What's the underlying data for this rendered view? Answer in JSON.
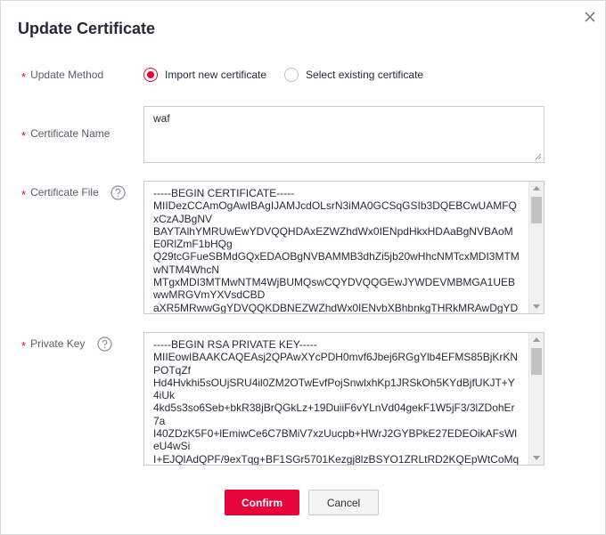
{
  "dialog": {
    "title": "Update Certificate",
    "close_icon": "close-icon"
  },
  "form": {
    "required_mark": "*",
    "update_method": {
      "label": "Update Method",
      "options": [
        {
          "label": "Import new certificate",
          "checked": true
        },
        {
          "label": "Select existing certificate",
          "checked": false
        }
      ]
    },
    "certificate_name": {
      "label": "Certificate Name",
      "value": "waf"
    },
    "certificate_file": {
      "label": "Certificate File",
      "help_icon": "question-circle-icon",
      "lines": [
        "-----BEGIN CERTIFICATE-----",
        "MIIDezCCAmOgAwIBAgIJAMJcdOLsrN3iMA0GCSqGSIb3DQEBCwUAMFQ",
        "xCzAJBgNV",
        "BAYTAlhYMRUwEwYDVQQHDAxEZWZhdWx0IENpdHkxHDAaBgNVBAoM",
        "E0RlZmF1bHQg",
        "Q29tcGFueSBMdGQxEDAOBgNVBAMMB3dhZi5jb20wHhcNMTcxMDI3MTM",
        "wNTM4WhcN",
        "MTgxMDI3MTMwNTM4WjBUMQswCQYDVQQGEwJYWDEVMBMGA1UEB",
        "wwMRGVmYXVsdCBD",
        "aXR5MRwwGgYDVQQKDBNEZWZhdWx0IENvbXBhbnkgTHRkMRAwDgYD"
      ]
    },
    "private_key": {
      "label": "Private Key",
      "help_icon": "question-circle-icon",
      "lines": [
        "-----BEGIN RSA PRIVATE KEY-----",
        "MIIEowIBAAKCAQEAsj2QPAwXYcPDH0mvf6Jbej6RGgYlb4EFMS85BjKrKN",
        "POTqZf",
        "Hd4Hvkhi5sOUjSRU4il0ZM2OTwEvfPojSnwlxhKp1JRSkOh5KYdBjfUKJT+Y",
        "4iUk",
        "4kd5s3so6Seb+bkR38jBrQGkLz+19DuiiF6vYLnVd04gekF1W5jF3/3lZDohEr",
        "7a",
        "I40ZDzK5F0+lEmiwCe6C7BMiV7xzUucpb+HWrJ2GYBPkE27EDEOikAFsWl",
        "eU4wSi",
        "I+EJQlAdQPF/9exTqg+BF1SGr5701Kezgj8lzBSYO1ZRLtRD2KQEpWtCoMq"
      ]
    }
  },
  "footer": {
    "confirm_label": "Confirm",
    "cancel_label": "Cancel"
  },
  "colors": {
    "accent": "#e6053a",
    "text": "#252b3a",
    "label": "#575d6c",
    "border": "#c8cbd0"
  }
}
